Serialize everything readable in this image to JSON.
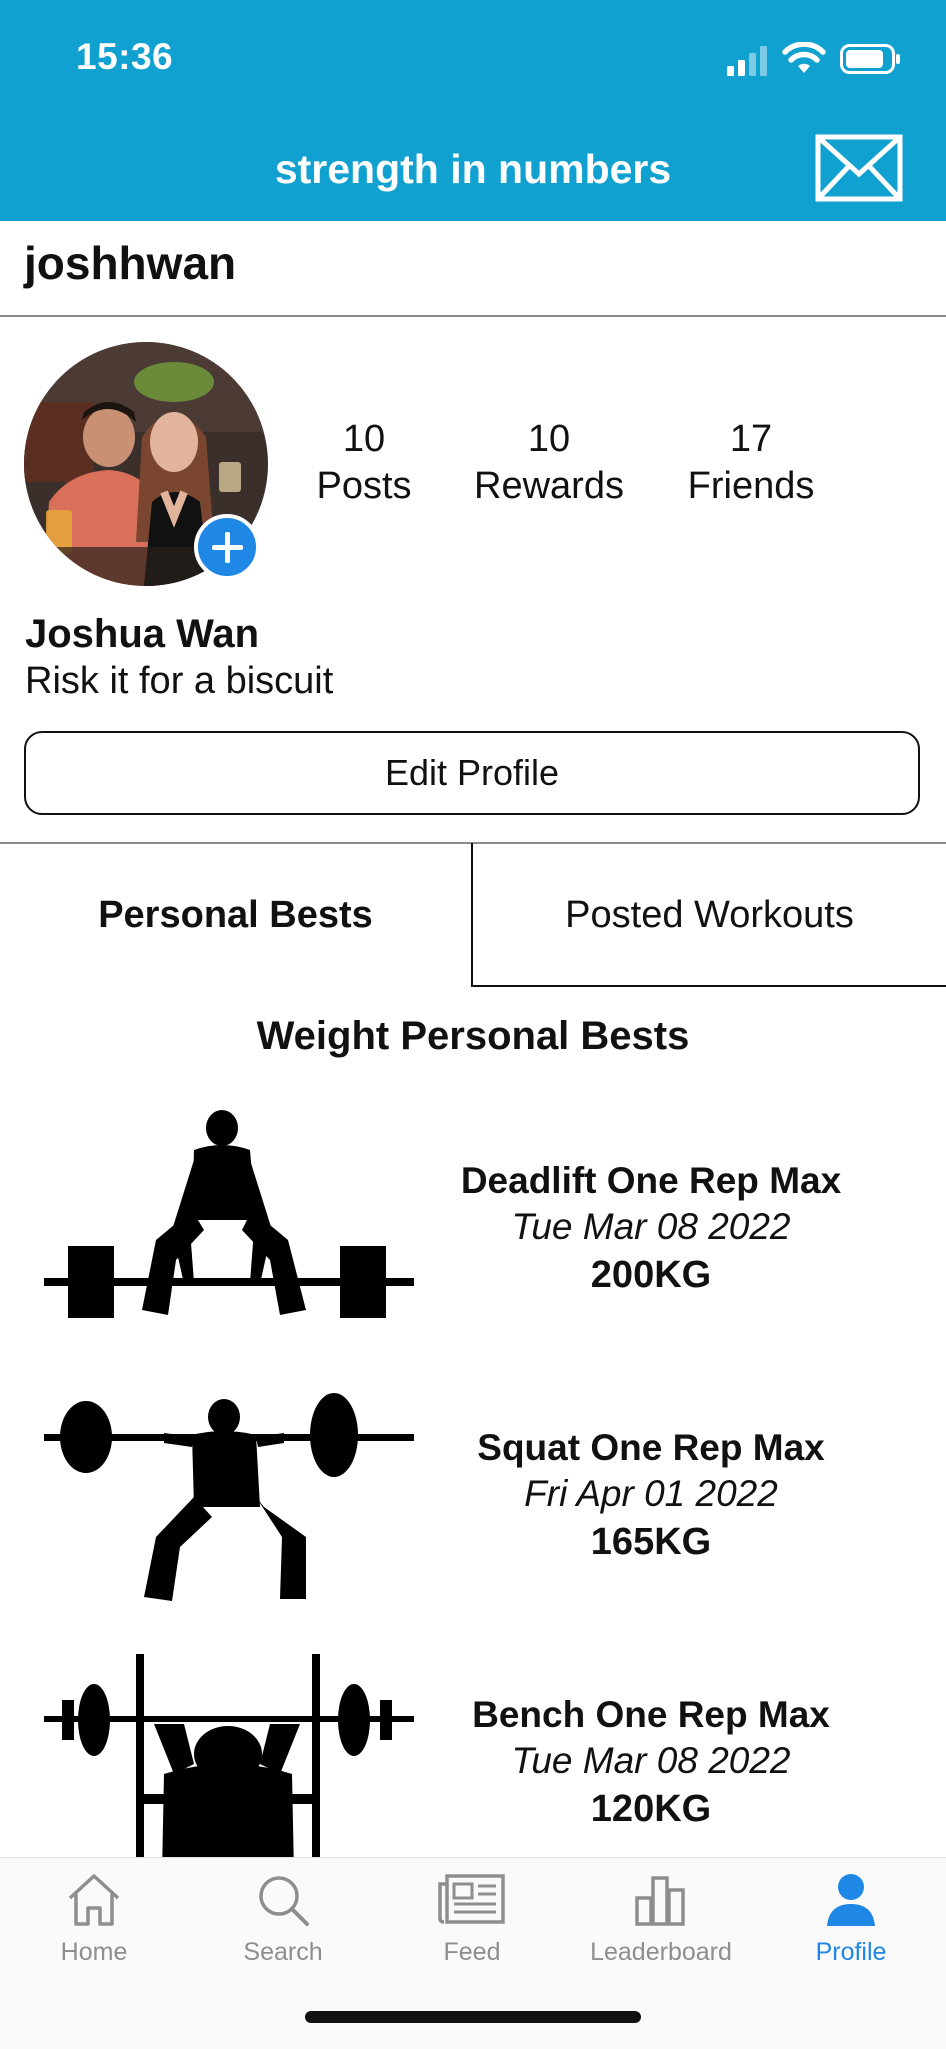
{
  "status_bar": {
    "time": "15:36"
  },
  "header": {
    "title": "strength in numbers"
  },
  "profile": {
    "username": "joshhwan",
    "full_name": "Joshua Wan",
    "bio": "Risk it for a biscuit",
    "edit_label": "Edit Profile",
    "stats": [
      {
        "value": "10",
        "label": "Posts"
      },
      {
        "value": "10",
        "label": "Rewards"
      },
      {
        "value": "17",
        "label": "Friends"
      }
    ]
  },
  "tabs": {
    "active": "Personal Bests",
    "inactive": "Posted Workouts"
  },
  "section_title": "Weight Personal Bests",
  "personal_bests": [
    {
      "title": "Deadlift One Rep Max",
      "date": "Tue Mar 08 2022",
      "weight": "200KG"
    },
    {
      "title": "Squat One Rep Max",
      "date": "Fri Apr 01 2022",
      "weight": "165KG"
    },
    {
      "title": "Bench One Rep Max",
      "date": "Tue Mar 08 2022",
      "weight": "120KG"
    }
  ],
  "nav": {
    "items": [
      {
        "label": "Home",
        "icon": "home-icon"
      },
      {
        "label": "Search",
        "icon": "search-icon"
      },
      {
        "label": "Feed",
        "icon": "newspaper-icon"
      },
      {
        "label": "Leaderboard",
        "icon": "bar-chart-icon"
      },
      {
        "label": "Profile",
        "icon": "person-icon"
      }
    ],
    "active": "Profile"
  },
  "colors": {
    "header": "#11a1d0",
    "accent": "#1f87e5",
    "nav_inactive": "#8e8e8e"
  }
}
